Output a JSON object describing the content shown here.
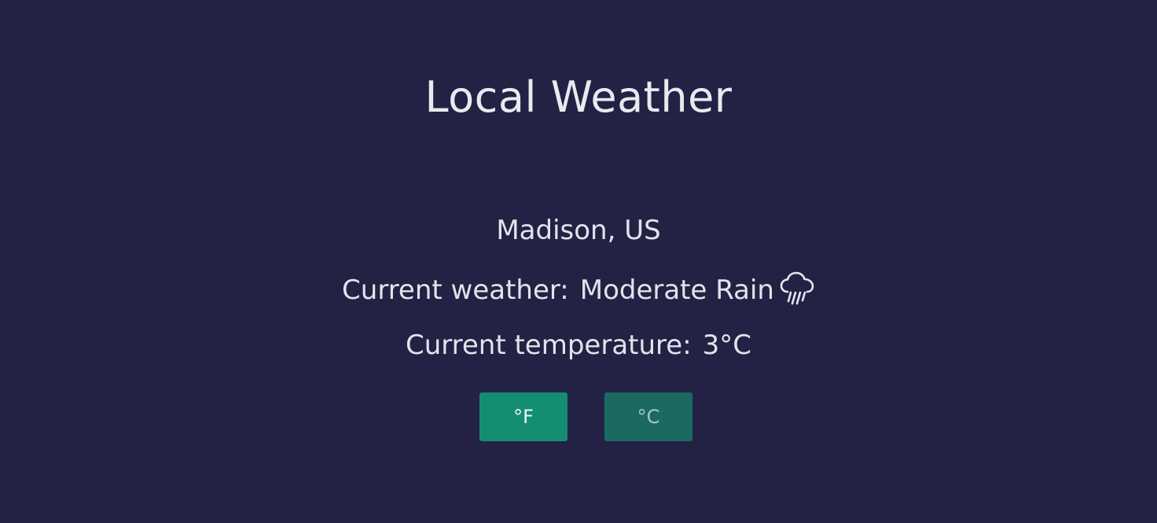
{
  "header": {
    "title": "Local Weather"
  },
  "location": {
    "text": "Madison, US"
  },
  "weather": {
    "label": "Current weather:",
    "value": "Moderate Rain",
    "icon": "rain-cloud-icon"
  },
  "temperature": {
    "label": "Current temperature:",
    "value": "3°C"
  },
  "units": {
    "fahrenheit_label": "°F",
    "celsius_label": "°C",
    "active_color": "#148e72",
    "inactive_color": "#1b6a62"
  },
  "colors": {
    "background": "#232244",
    "text": "#e6e6ee"
  }
}
